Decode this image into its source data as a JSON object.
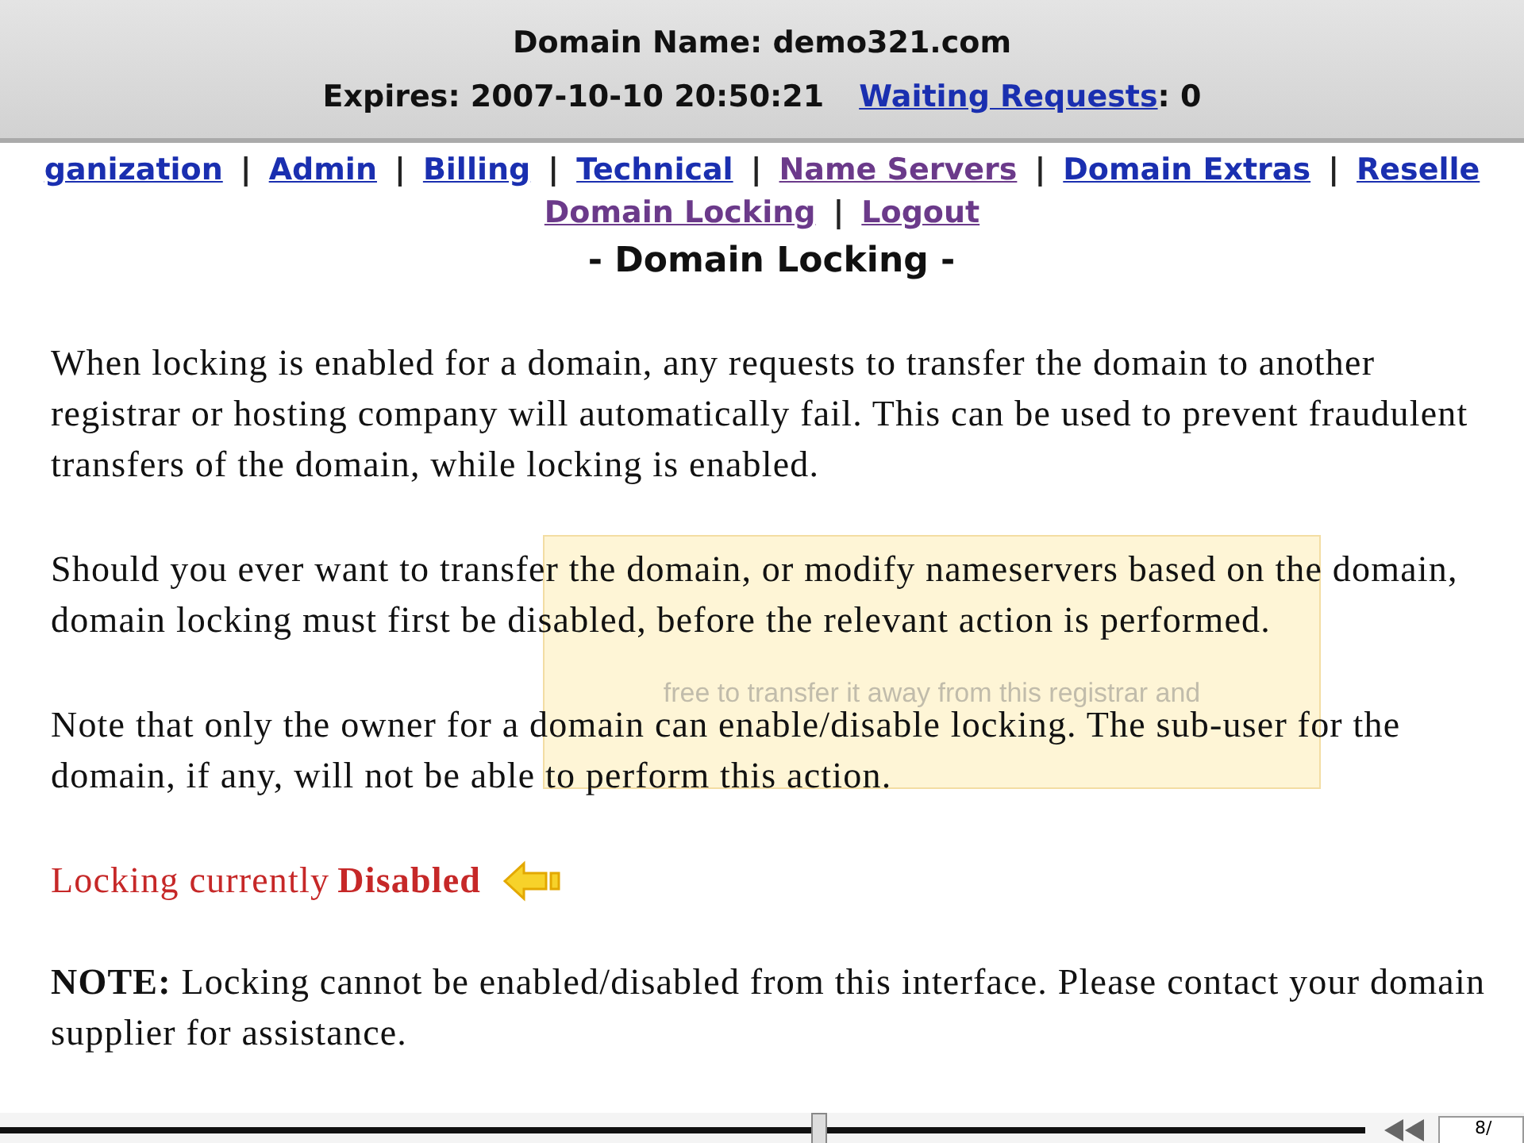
{
  "header": {
    "domain_label": "Domain Name:",
    "domain": "demo321.com",
    "expires_label": "Expires:",
    "expires": "2007-10-10 20:50:21",
    "waiting_link": "Waiting Requests",
    "waiting_count": ": 0"
  },
  "nav": [
    {
      "label": "ganization",
      "visited": false
    },
    {
      "label": "Admin",
      "visited": false
    },
    {
      "label": "Billing",
      "visited": false
    },
    {
      "label": "Technical",
      "visited": false
    },
    {
      "label": "Name Servers",
      "visited": true
    },
    {
      "label": "Domain Extras",
      "visited": false
    },
    {
      "label": "Reselle",
      "visited": false
    },
    {
      "label": "Domain Locking",
      "visited": true
    },
    {
      "label": "Logout",
      "visited": true
    }
  ],
  "nav_separator": "|",
  "page_title": "- Domain Locking -",
  "paragraphs": [
    "When locking is enabled for a domain, any requests to transfer the domain to another registrar or hosting company will automatically fail. This can be used to prevent fraudulent transfers of the domain, while locking is enabled.",
    "Should you ever want to transfer the domain, or modify nameservers based on the domain, domain locking must first be disabled, before the relevant action is performed.",
    "Note that only the owner for a domain can enable/disable locking. The sub-user for the domain, if any, will not be able to perform this action."
  ],
  "status": {
    "label": "Locking currently",
    "value": "Disabled"
  },
  "note": "**NOTE:** Locking cannot be enabled/disabled from this interface. Please contact your domain supplier for assistance.",
  "tooltip": {
    "text": "free to transfer it away from this registrar and"
  },
  "player": {
    "level": 0.6,
    "time": "8/"
  }
}
